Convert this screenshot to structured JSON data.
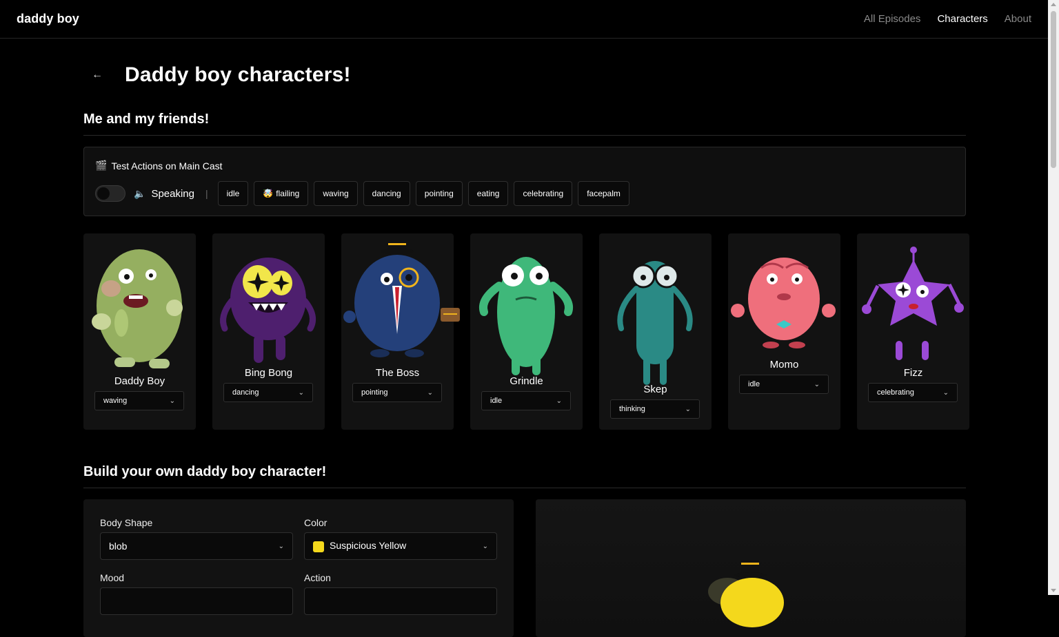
{
  "nav": {
    "brand": "daddy boy",
    "links": [
      {
        "label": "All Episodes",
        "active": false
      },
      {
        "label": "Characters",
        "active": true
      },
      {
        "label": "About",
        "active": false
      }
    ]
  },
  "page": {
    "back_icon": "←",
    "title": "Daddy boy characters!"
  },
  "friends": {
    "heading": "Me and my friends!",
    "test_panel": {
      "icon": "🎬",
      "title": "Test Actions on Main Cast",
      "speaker_icon": "🔈",
      "speaking_label": "Speaking",
      "separator": "|",
      "actions": [
        {
          "label": "idle",
          "emoji": ""
        },
        {
          "label": "flailing",
          "emoji": "🤯"
        },
        {
          "label": "waving",
          "emoji": ""
        },
        {
          "label": "dancing",
          "emoji": ""
        },
        {
          "label": "pointing",
          "emoji": ""
        },
        {
          "label": "eating",
          "emoji": ""
        },
        {
          "label": "celebrating",
          "emoji": ""
        },
        {
          "label": "facepalm",
          "emoji": ""
        }
      ]
    },
    "characters": [
      {
        "name": "Daddy Boy",
        "action": "waving",
        "color": "#a7c46a"
      },
      {
        "name": "Bing Bong",
        "action": "dancing",
        "color": "#5b2a7a"
      },
      {
        "name": "The Boss",
        "action": "pointing",
        "color": "#24407a"
      },
      {
        "name": "Grindle",
        "action": "idle",
        "color": "#3fb87a"
      },
      {
        "name": "Skep",
        "action": "thinking",
        "color": "#2a8a85"
      },
      {
        "name": "Momo",
        "action": "idle",
        "color": "#ef6f7c"
      },
      {
        "name": "Fizz",
        "action": "celebrating",
        "color": "#9b4ad6"
      }
    ]
  },
  "builder": {
    "heading": "Build your own daddy boy character!",
    "body_shape_label": "Body Shape",
    "body_shape_value": "blob",
    "color_label": "Color",
    "color_value": "Suspicious Yellow",
    "color_swatch": "#f4d81c",
    "mood_label": "Mood",
    "action_label": "Action"
  },
  "chevron": "⌄"
}
